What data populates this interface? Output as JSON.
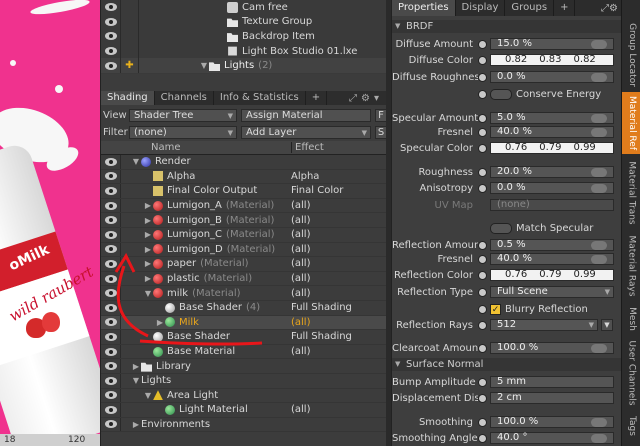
{
  "viewport": {
    "ruler_labels": [
      "18",
      "120"
    ],
    "can_brand": "oMilk",
    "can_flavor": "wild raubert"
  },
  "item_list": {
    "rows": [
      {
        "label": "Cam free",
        "dim": ""
      },
      {
        "label": "Texture Group",
        "dim": ""
      },
      {
        "label": "Backdrop Item",
        "dim": ""
      },
      {
        "label": "Light Box Studio 01.lxe",
        "dim": ""
      },
      {
        "label": "Lights",
        "dim": "(2)"
      }
    ]
  },
  "shading_panel": {
    "tabs": [
      "Shading",
      "Channels",
      "Info & Statistics",
      "+"
    ],
    "view_label": "View",
    "view_value": "Shader Tree",
    "assign_material": "Assign Material",
    "f_button": "F",
    "filter_label": "Filter",
    "filter_value": "(none)",
    "add_layer": "Add Layer",
    "s_button": "S",
    "col_name": "Name",
    "col_effect": "Effect"
  },
  "shader_tree": [
    {
      "label": "Render",
      "dim": "",
      "effect": "",
      "icon": "sphere-blue",
      "indent": 0,
      "tri": "▼"
    },
    {
      "label": "Alpha",
      "dim": "",
      "effect": "Alpha",
      "icon": "alpha",
      "indent": 1,
      "tri": ""
    },
    {
      "label": "Final Color Output",
      "dim": "",
      "effect": "Final Color",
      "icon": "alpha",
      "indent": 1,
      "tri": ""
    },
    {
      "label": "Lumigon_A",
      "dim": "(Material)",
      "effect": "(all)",
      "icon": "sphere-red",
      "indent": 1,
      "tri": "▶"
    },
    {
      "label": "Lumigon_B",
      "dim": "(Material)",
      "effect": "(all)",
      "icon": "sphere-red",
      "indent": 1,
      "tri": "▶"
    },
    {
      "label": "Lumigon_C",
      "dim": "(Material)",
      "effect": "(all)",
      "icon": "sphere-red",
      "indent": 1,
      "tri": "▶"
    },
    {
      "label": "Lumigon_D",
      "dim": "(Material)",
      "effect": "(all)",
      "icon": "sphere-red",
      "indent": 1,
      "tri": "▶"
    },
    {
      "label": "paper",
      "dim": "(Material)",
      "effect": "(all)",
      "icon": "sphere-red",
      "indent": 1,
      "tri": "▶"
    },
    {
      "label": "plastic",
      "dim": "(Material)",
      "effect": "(all)",
      "icon": "sphere-red",
      "indent": 1,
      "tri": "▶"
    },
    {
      "label": "milk",
      "dim": "(Material)",
      "effect": "(all)",
      "icon": "sphere-red",
      "indent": 1,
      "tri": "▼"
    },
    {
      "label": "Base Shader",
      "dim": "(4)",
      "effect": "Full Shading",
      "icon": "sphere-white",
      "indent": 2,
      "tri": ""
    },
    {
      "label": "Milk",
      "dim": "",
      "effect": "(all)",
      "icon": "sphere-green",
      "indent": 2,
      "tri": "▶",
      "selected": true
    },
    {
      "label": "Base Shader",
      "dim": "",
      "effect": "Full Shading",
      "icon": "sphere-white",
      "indent": 1,
      "tri": ""
    },
    {
      "label": "Base Material",
      "dim": "",
      "effect": "(all)",
      "icon": "sphere-green",
      "indent": 1,
      "tri": ""
    },
    {
      "label": "Library",
      "dim": "",
      "effect": "",
      "icon": "folder",
      "indent": 0,
      "tri": "▶"
    },
    {
      "label": "Lights",
      "dim": "",
      "effect": "",
      "icon": "none",
      "indent": 0,
      "tri": "▼"
    },
    {
      "label": "Area Light",
      "dim": "",
      "effect": "",
      "icon": "yellow",
      "indent": 1,
      "tri": "▼"
    },
    {
      "label": "Light Material",
      "dim": "",
      "effect": "(all)",
      "icon": "sphere-green",
      "indent": 2,
      "tri": ""
    },
    {
      "label": "Environments",
      "dim": "",
      "effect": "",
      "icon": "none",
      "indent": 0,
      "tri": "▶"
    }
  ],
  "properties": {
    "tabs": [
      "Properties",
      "Display",
      "Groups",
      "+"
    ],
    "sections": {
      "brdf": "BRDF",
      "surface_normal": "Surface Normal"
    },
    "diffuse_amount": {
      "label": "Diffuse Amount",
      "value": "15.0 %"
    },
    "diffuse_color": {
      "label": "Diffuse Color",
      "r": "0.82",
      "g": "0.83",
      "b": "0.82"
    },
    "diffuse_roughness": {
      "label": "Diffuse Roughness",
      "value": "0.0 %"
    },
    "conserve_energy": "Conserve Energy",
    "specular_amount": {
      "label": "Specular Amount",
      "value": "5.0 %"
    },
    "fresnel1": {
      "label": "Fresnel",
      "value": "40.0 %"
    },
    "specular_color": {
      "label": "Specular Color",
      "r": "0.76",
      "g": "0.79",
      "b": "0.99"
    },
    "roughness": {
      "label": "Roughness",
      "value": "20.0 %"
    },
    "anisotropy": {
      "label": "Anisotropy",
      "value": "0.0 %"
    },
    "uv_map": {
      "label": "UV Map",
      "value": "(none)"
    },
    "match_specular": "Match Specular",
    "reflection_amount": {
      "label": "Reflection Amount",
      "value": "0.5 %"
    },
    "fresnel2": {
      "label": "Fresnel",
      "value": "40.0 %"
    },
    "reflection_color": {
      "label": "Reflection Color",
      "r": "0.76",
      "g": "0.79",
      "b": "0.99"
    },
    "reflection_type": {
      "label": "Reflection Type",
      "value": "Full Scene"
    },
    "blurry_reflection": "Blurry Reflection",
    "reflection_rays": {
      "label": "Reflection Rays",
      "value": "512"
    },
    "clearcoat_amount": {
      "label": "Clearcoat Amount",
      "value": "100.0 %"
    },
    "bump_amplitude": {
      "label": "Bump Amplitude",
      "value": "5 mm"
    },
    "displacement_distance": {
      "label": "Displacement Dis...",
      "value": "2 cm"
    },
    "smoothing": {
      "label": "Smoothing",
      "value": "100.0 %"
    },
    "smoothing_angle": {
      "label": "Smoothing Angle",
      "value": "40.0 °"
    }
  },
  "vertical_tabs": [
    "Group Locator",
    "Material Ref",
    "Material Trans",
    "Material Rays",
    "Mesh",
    "User Channels",
    "Tags"
  ],
  "colors": {
    "accent": "#e07c1c",
    "selected_text": "#e9a61c",
    "viewport_bg": "#f0328e",
    "annotation": "#e8161a"
  }
}
